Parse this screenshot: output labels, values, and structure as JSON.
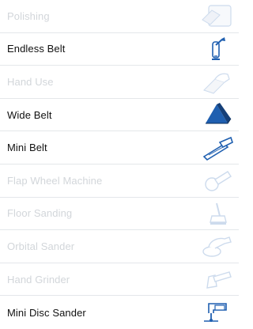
{
  "sanding_types": [
    {
      "label": "Polishing",
      "state": "disabled",
      "icon": "polishing-icon"
    },
    {
      "label": "Endless Belt",
      "state": "active",
      "icon": "endless-belt-icon"
    },
    {
      "label": "Hand Use",
      "state": "disabled",
      "icon": "hand-use-icon"
    },
    {
      "label": "Wide Belt",
      "state": "active",
      "icon": "wide-belt-icon"
    },
    {
      "label": "Mini Belt",
      "state": "active",
      "icon": "mini-belt-icon"
    },
    {
      "label": "Flap Wheel Machine",
      "state": "disabled",
      "icon": "flap-wheel-machine-icon"
    },
    {
      "label": "Floor Sanding",
      "state": "disabled",
      "icon": "floor-sanding-icon"
    },
    {
      "label": "Orbital Sander",
      "state": "disabled",
      "icon": "orbital-sander-icon"
    },
    {
      "label": "Hand Grinder",
      "state": "disabled",
      "icon": "hand-grinder-icon"
    },
    {
      "label": "Mini Disc Sander",
      "state": "active",
      "icon": "mini-disc-sander-icon"
    }
  ],
  "colors": {
    "active_text": "#111111",
    "disabled_text": "#d2d6da",
    "icon_blue": "#1f5fb0",
    "divider": "#e4e7ea"
  }
}
